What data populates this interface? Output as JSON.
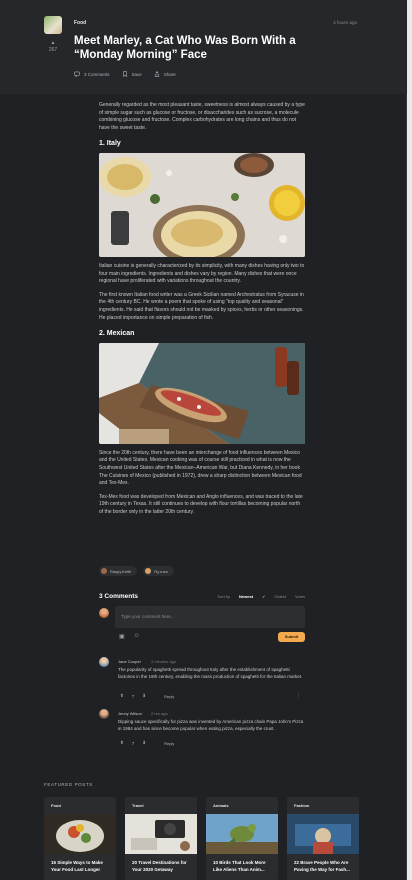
{
  "post": {
    "category": "Food",
    "time_ago": "2 hours ago",
    "vote_count": "267",
    "title": "Meet Marley, a Cat Who Was Born With a “Monday Morning” Face",
    "actions": {
      "comments": "3 Comments",
      "save": "Save",
      "share": "Share"
    }
  },
  "article": {
    "intro": "Generally regarded as the most pleasant taste, sweetness is almost always caused by a type of simple sugar such as glucose or fructose, or disaccharides such as sucrose, a molecule combining glucose and fructose. Complex carbohydrates are long chains and thus do not have the sweet taste.",
    "sections": [
      {
        "heading": "1. Italy",
        "paragraphs": [
          "Italian cuisine is generally characterized by its simplicity, with many dishes having only two to four main ingredients. Ingredients and dishes vary by region. Many dishes that were once regional have proliferated with variations throughout the country.",
          "The first known Italian food writer was a Greek Sicilian named Archestratus from Syracuse in the 4th century BC. He wrote a poem that spoke of using “top quality and seasonal” ingredients. He said that flavors should not be masked by spices, herbs or other seasonings. He placed importance on simple preparation of fish."
        ]
      },
      {
        "heading": "2. Mexican",
        "paragraphs": [
          "Since the 20th century, there have been an interchange of food influences between Mexico and the United States. Mexican cooking was of course still practiced in what is now the Southwest United States after the Mexican–American War, but Diana Kennedy, in her book The Cuisines of Mexico (published in 1972), drew a sharp distinction between Mexican food and Tex-Mex.",
          "Tex-Mex food was developed from Mexican and Anglo influences, and was traced to the late 19th century in Texas. It still continues to develop with flour tortillas becoming popular north of the border only in the latter 20th century."
        ]
      }
    ]
  },
  "tags": [
    "Raspy.Keith",
    "Ry.ruca"
  ],
  "comments": {
    "title": "3 Comments",
    "sort_label": "Sort by",
    "sort_options": [
      "Newest",
      "Oldest",
      "Votes"
    ],
    "sort_active": "Newest",
    "composer_placeholder": "Type your comment here...",
    "submit_label": "Submit",
    "items": [
      {
        "author": "Jane Cooper",
        "time": "3 minutes ago",
        "text": "The popularity of spaghetti spread throughout Italy after the establishment of spaghetti factories in the 19th century, enabling the mass production of spaghetti for the Italian market.",
        "votes": "7",
        "reply_label": "Reply"
      },
      {
        "author": "Jenny Wilson",
        "time": "2 hrs ago",
        "text": "Dipping sauce specifically for pizza was invented by American pizza chain Papa John's Pizza in 1984 and has since become popular when eating pizza, especially the crust.",
        "votes": "7",
        "reply_label": "Reply"
      }
    ]
  },
  "featured": {
    "label": "FEATURED POSTS",
    "cards": [
      {
        "category": "Food",
        "title": "15 Simple Ways to Make Your Food Last Longer"
      },
      {
        "category": "Travel",
        "title": "20 Travel Destinations for Your 2020 Getaway"
      },
      {
        "category": "Animals",
        "title": "10 Birds That Look More Like Aliens Than Anim..."
      },
      {
        "category": "Fashion",
        "title": "22 Brave People Who Are Paving the Way for Fash..."
      }
    ]
  },
  "colors": {
    "background": "#1f2124",
    "surface": "#2a2c30",
    "accent": "#f3a94e",
    "text": "#e6e6e6"
  },
  "icons": [
    "comment-icon",
    "bookmark-icon",
    "share-icon",
    "upvote-icon",
    "downvote-icon",
    "image-icon",
    "emoji-icon",
    "more-icon"
  ]
}
